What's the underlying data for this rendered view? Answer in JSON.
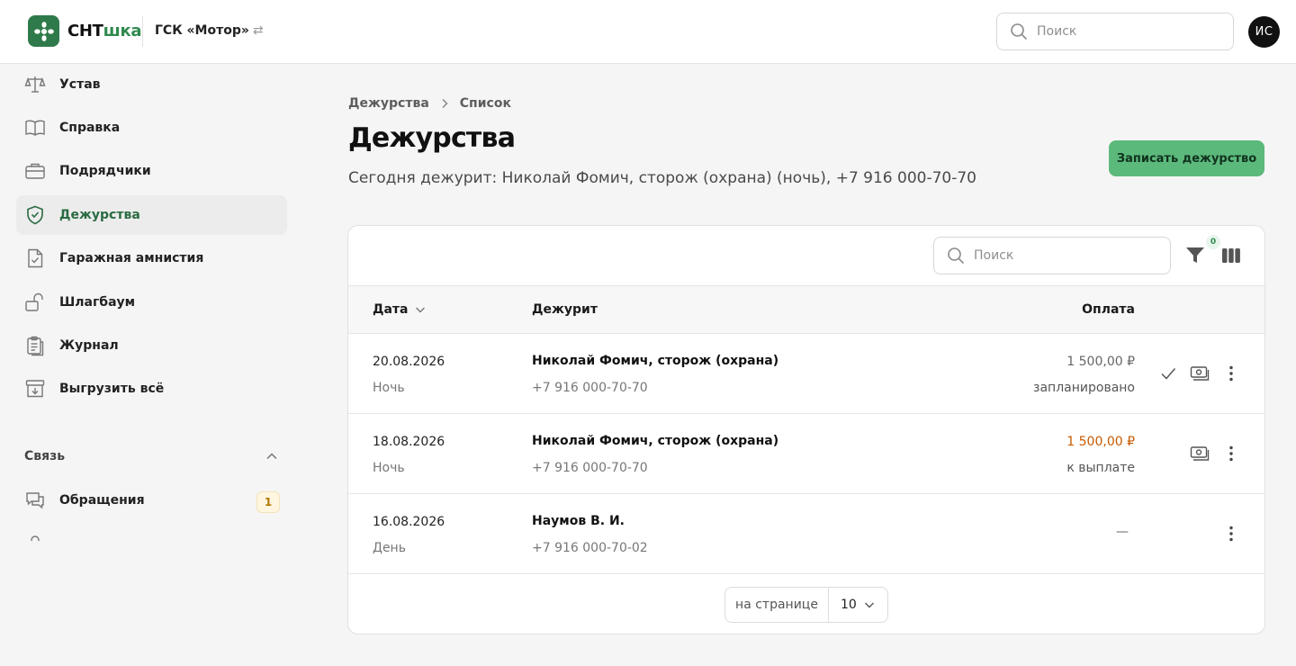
{
  "header": {
    "brand_part1": "СНТ",
    "brand_part2": "шка",
    "org_name": "ГСК «Мотор»",
    "org_switch_glyph": "⇄",
    "search_placeholder": "Поиск",
    "avatar_initials": "ИС"
  },
  "sidebar": {
    "items": [
      {
        "label": "Устав",
        "icon": "scales-icon"
      },
      {
        "label": "Справка",
        "icon": "book-icon"
      },
      {
        "label": "Подрядчики",
        "icon": "briefcase-icon"
      },
      {
        "label": "Дежурства",
        "icon": "shield-check-icon",
        "active": true
      },
      {
        "label": "Гаражная амнистия",
        "icon": "document-check-icon"
      },
      {
        "label": "Шлагбаум",
        "icon": "unlock-icon"
      },
      {
        "label": "Журнал",
        "icon": "clipboard-icon"
      },
      {
        "label": "Выгрузить всё",
        "icon": "archive-download-icon"
      }
    ],
    "section_title": "Связь",
    "section_items": [
      {
        "label": "Обращения",
        "icon": "chat-icon",
        "badge": "1"
      }
    ]
  },
  "main": {
    "breadcrumbs": [
      "Дежурства",
      "Список"
    ],
    "title": "Дежурства",
    "subtitle": "Сегодня дежурит: Николай Фомич, сторож (охрана) (ночь), +7 916 000-70-70",
    "primary_button": "Записать дежурство",
    "table": {
      "search_placeholder": "Поиск",
      "filter_count": "0",
      "columns": {
        "date": "Дата",
        "person": "Дежурит",
        "payment": "Оплата"
      },
      "rows": [
        {
          "date": "20.08.2026",
          "shift": "Ночь",
          "name": "Николай Фомич, сторож (охрана)",
          "phone": "+7 916 000-70-70",
          "amount": "1 500,00 ₽",
          "status": "запланировано"
        },
        {
          "date": "18.08.2026",
          "shift": "Ночь",
          "name": "Николай Фомич, сторож (охрана)",
          "phone": "+7 916 000-70-70",
          "amount": "1 500,00 ₽",
          "status": "к выплате"
        },
        {
          "date": "16.08.2026",
          "shift": "День",
          "name": "Наумов В. И.",
          "phone": "+7 916 000-70-02",
          "amount": "—",
          "status": ""
        }
      ],
      "pager": {
        "label": "на странице",
        "value": "10"
      }
    }
  },
  "colors": {
    "accent": "#2f7a4a",
    "button": "#5cb97c",
    "due": "#c75a00"
  }
}
